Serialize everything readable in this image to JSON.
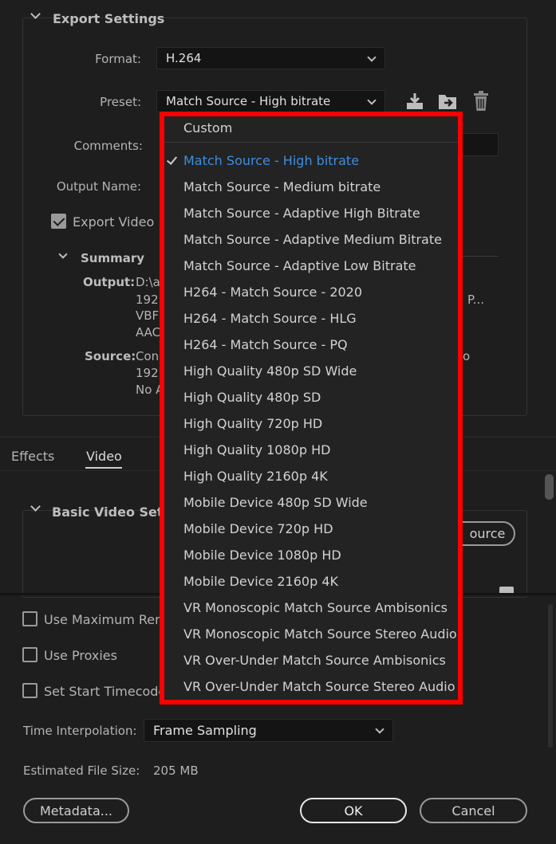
{
  "export_settings": {
    "title": "Export Settings",
    "format_label": "Format:",
    "format_value": "H.264",
    "preset_label": "Preset:",
    "preset_value": "Match Source - High bitrate",
    "comments_label": "Comments:",
    "output_name_label": "Output Name:",
    "export_video_label": "Export Video",
    "summary_title": "Summary",
    "output_label": "Output:",
    "output_lines": [
      "D:\\a",
      "192",
      "VBF",
      "AAC"
    ],
    "output_trailing": "P...",
    "source_label": "Source:",
    "source_lines": [
      "Con",
      "192",
      "No A"
    ],
    "source_trailing": "o"
  },
  "tabs": {
    "effects": "Effects",
    "video": "Video"
  },
  "video_section": {
    "basic_title": "Basic Video Setti",
    "match_source_button": "ource"
  },
  "options": {
    "use_max_render": "Use Maximum Ren",
    "use_proxies": "Use Proxies",
    "set_start_timecode": "Set Start Timecode",
    "time_interpolation_label": "Time Interpolation:",
    "time_interpolation_value": "Frame Sampling",
    "estimated_size_label": "Estimated File Size:",
    "estimated_size_value": "205 MB"
  },
  "buttons": {
    "metadata": "Metadata...",
    "ok": "OK",
    "cancel": "Cancel"
  },
  "preset_dropdown": {
    "items": [
      "Custom",
      "Match Source - High bitrate",
      "Match Source - Medium bitrate",
      "Match Source - Adaptive High Bitrate",
      "Match Source - Adaptive Medium Bitrate",
      "Match Source - Adaptive Low Bitrate",
      "H264 - Match Source - 2020",
      "H264 - Match Source - HLG",
      "H264 - Match Source - PQ",
      "High Quality 480p SD Wide",
      "High Quality 480p SD",
      "High Quality 720p HD",
      "High Quality 1080p HD",
      "High Quality 2160p 4K",
      "Mobile Device 480p SD Wide",
      "Mobile Device 720p HD",
      "Mobile Device 1080p HD",
      "Mobile Device 2160p 4K",
      "VR Monoscopic Match Source Ambisonics",
      "VR Monoscopic Match Source Stereo Audio",
      "VR Over-Under Match Source Ambisonics",
      "VR Over-Under Match Source Stereo Audio"
    ],
    "selected_index": 1
  },
  "colors": {
    "highlight_box": "#ff0000",
    "selected_item": "#3d8ee0",
    "background": "#1e1e1e"
  }
}
